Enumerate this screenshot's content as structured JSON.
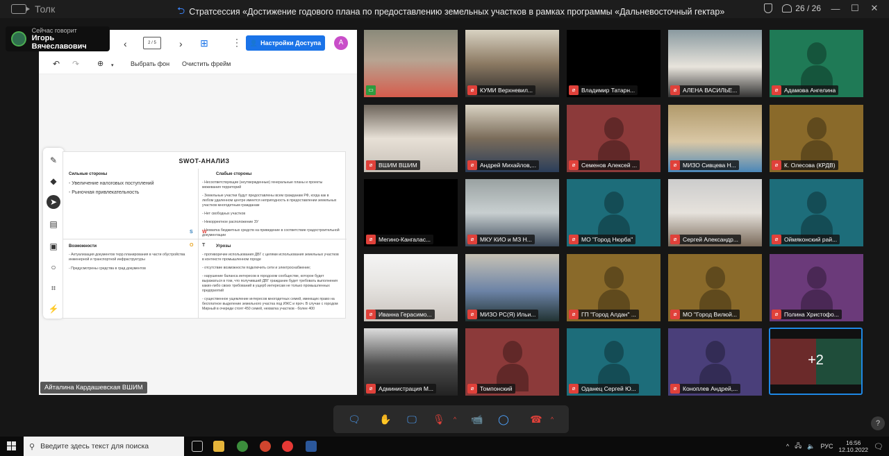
{
  "app": {
    "name": "Толк"
  },
  "meeting": {
    "title": "Стратсессия «Достижение годового плана по предоставлению земельных участков в рамках программы «Дальневосточный гектар»",
    "participants": "26 / 26"
  },
  "speaking": {
    "label": "Сейчас говорит",
    "name": "Игорь Вячеславович"
  },
  "whiteboard": {
    "page_indicator": "2 / 5",
    "access_button": "Настройки Доступа",
    "avatar_letter": "А",
    "bg_button": "Выбрать фон",
    "clear_button": "Очистить фрейм",
    "swot": {
      "title": "SWOT-АНАЛИЗ",
      "strengths_title": "Сильные стороны",
      "strengths": [
        "- Увеличение налоговых поступлений",
        "- Рыночная привлекательность"
      ],
      "weaknesses_title": "Слабые стороны",
      "weaknesses": [
        "- Несоответствующие (неутвержденные) генеральные планы и проекты межевания территорий",
        "- Земельные участки будут предоставлены всем гражданам РФ, когда как в любом удаленном центре имеется непригодность в предоставлении земельных участков многодетным гражданам",
        "- Нет свободных участков",
        "- Некорректное расположение ЗУ",
        "- Нехватка бюджетных средств на приведение в соответствие градостроительной документации"
      ],
      "opportunities_title": "Возможности",
      "opportunities": [
        "- Актуализация документов терр.планирования в части обустройства инженерной и транспортной инфраструктуры",
        "- Предусмотрены средства в град документов"
      ],
      "threats_title": "Угрозы",
      "threats": [
        "- противоречие использования ДВГ с целями использования земельных участков в контексте промышленном городе",
        "- отсутствие возможности подключить сети и электроснабжение;",
        "- нарушение баланса интересов в городском сообществе, которое будет выражаться в том, что получивший ДВГ гражданин будет требовать выполнения каких-либо своих требований в ущерб интересам не только промышленных предприятий",
        "- существенное ущемление интересов многодетных семей, имеющих право на бесплатное выделение земельного участка под ИЖС и проч. В случае с городом Мирный в очереди стоят 450 семей, нехватка участков - более 400"
      ],
      "letters": {
        "s": "S",
        "w": "W",
        "o": "O",
        "t": "T"
      }
    },
    "presenter": "Айталина Кардашевская ВШИМ"
  },
  "tiles": [
    {
      "name": "",
      "mic": "on"
    },
    {
      "name": "КУМИ Верхневил..."
    },
    {
      "name": "Владимир Татарн..."
    },
    {
      "name": "АЛЕНА ВАСИЛЬЕ..."
    },
    {
      "name": "Адамова Ангелина"
    },
    {
      "name": "ВШИМ ВШИМ"
    },
    {
      "name": "Андрей Михайлов,..."
    },
    {
      "name": "Семенов Алексей ..."
    },
    {
      "name": "МИЗО Сивцева Н..."
    },
    {
      "name": "К. Олесова (КРДВ)"
    },
    {
      "name": "Мегино-Кангалас..."
    },
    {
      "name": "МКУ КИО и МЗ Н..."
    },
    {
      "name": "МО \"Город Нюрба\""
    },
    {
      "name": "Сергей Александр..."
    },
    {
      "name": "Оймяконский рай..."
    },
    {
      "name": "Иванна Герасимо..."
    },
    {
      "name": "МИЗО РС(Я) Ильи..."
    },
    {
      "name": "ГП \"Город Алдан\" ..."
    },
    {
      "name": "МО \"Город Вилюй..."
    },
    {
      "name": "Полина Христофо..."
    },
    {
      "name": "Администрация М..."
    },
    {
      "name": "Томпонский"
    },
    {
      "name": "Оданец Сергей Ю..."
    },
    {
      "name": "Коноплев Андрей,..."
    }
  ],
  "more_count": "+2",
  "taskbar": {
    "search_placeholder": "Введите здесь текст для поиска",
    "lang": "РУС",
    "time": "16:56",
    "date": "12.10.2022"
  }
}
